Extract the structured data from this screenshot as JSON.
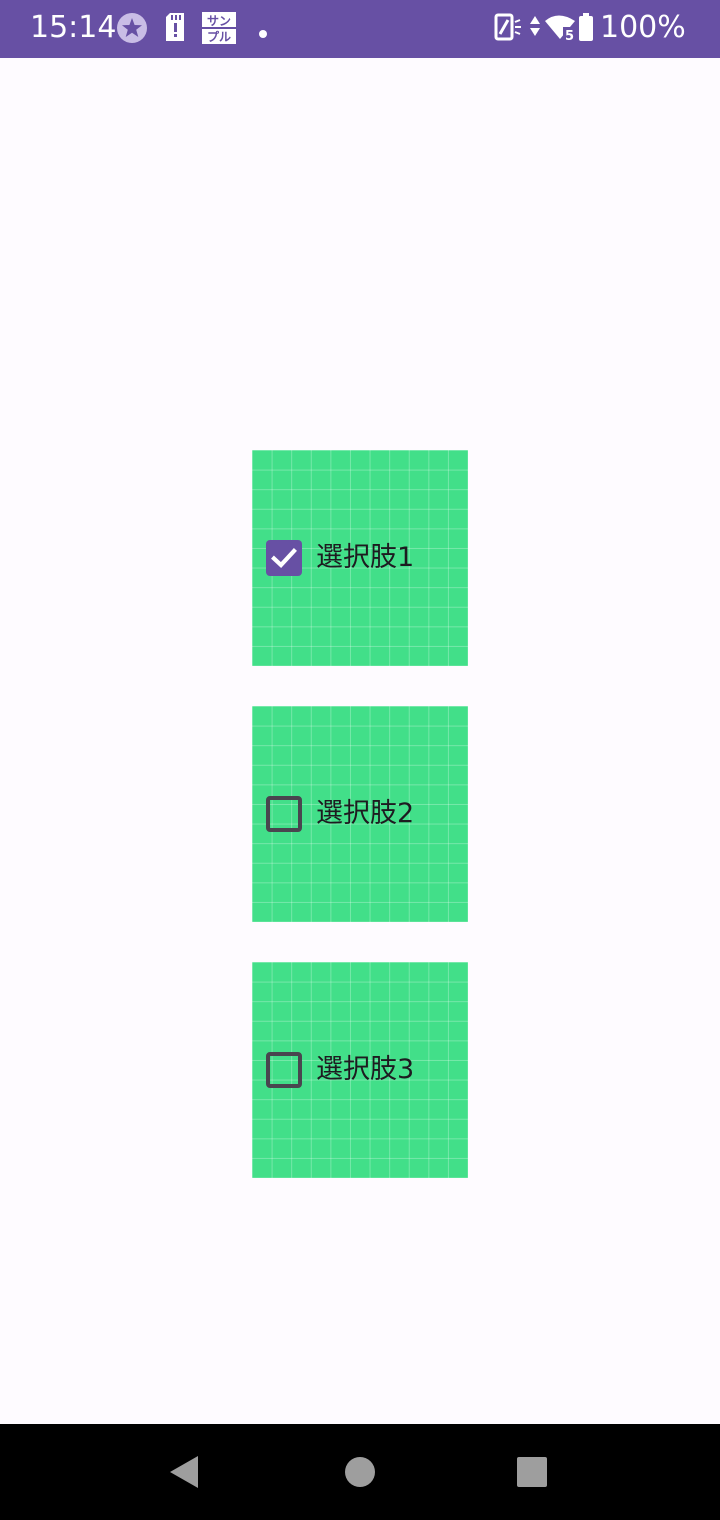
{
  "status_bar": {
    "time": "15:14",
    "battery": "100%",
    "sample_badge": [
      "サン",
      "プル"
    ],
    "network_label": "5",
    "icons": [
      "star-icon",
      "sd-card-alert-icon",
      "sample-badge-icon",
      "notification-dot-icon",
      "vibrate-icon",
      "data-arrows-icon",
      "wifi-icon",
      "battery-icon"
    ]
  },
  "options": [
    {
      "label": "選択肢1",
      "checked": true
    },
    {
      "label": "選択肢2",
      "checked": false
    },
    {
      "label": "選択肢3",
      "checked": false
    }
  ],
  "colors": {
    "accent": "#6750a4",
    "card_background": "#42df89",
    "page_background": "#fefbff",
    "text": "#1d1b20"
  },
  "nav_bar": {
    "buttons": [
      "back-icon",
      "home-icon",
      "recents-icon"
    ]
  }
}
